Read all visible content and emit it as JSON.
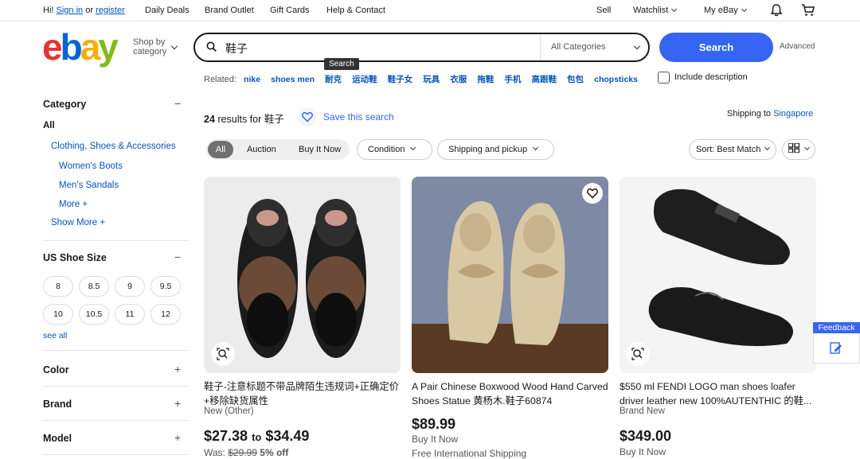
{
  "topbar": {
    "greeting": "Hi!",
    "sign_in": "Sign in",
    "or": "or",
    "register": "register",
    "daily_deals": "Daily Deals",
    "brand_outlet": "Brand Outlet",
    "gift_cards": "Gift Cards",
    "help_contact": "Help & Contact",
    "sell": "Sell",
    "watchlist": "Watchlist",
    "my_ebay": "My eBay"
  },
  "header": {
    "logo_letters": [
      "e",
      "b",
      "a",
      "y"
    ],
    "shop_by_line1": "Shop by",
    "shop_by_line2": "category",
    "search_query": "鞋子",
    "category_select": "All Categories",
    "tooltip": "Search",
    "search_button": "Search",
    "advanced": "Advanced",
    "related_label": "Related:",
    "related": [
      "nike",
      "shoes men",
      "耐克",
      "运动鞋",
      "鞋子女",
      "玩具",
      "衣服",
      "拖鞋",
      "手机",
      "高跟鞋",
      "包包",
      "chopsticks"
    ],
    "include_description": "Include description"
  },
  "sidebar": {
    "category_title": "Category",
    "all": "All",
    "category_items": [
      "Clothing, Shoes & Accessories",
      "Women's Boots",
      "Men's Sandals",
      "More +"
    ],
    "show_more": "Show More +",
    "size_title": "US Shoe Size",
    "sizes": [
      "8",
      "8.5",
      "9",
      "9.5",
      "10",
      "10.5",
      "11",
      "12"
    ],
    "see_all": "see all",
    "color_title": "Color",
    "brand_title": "Brand",
    "model_title": "Model"
  },
  "results": {
    "count_prefix": "24",
    "count_mid": "results for",
    "count_query": "鞋子",
    "save_search": "Save this search",
    "shipping_to": "Shipping to",
    "shipping_country": "Singapore",
    "filters": [
      "All",
      "Auction",
      "Buy It Now"
    ],
    "condition": "Condition",
    "shipping_pickup": "Shipping and pickup",
    "sort": "Sort: Best Match"
  },
  "products": [
    {
      "title": "鞋子-注意标题不带品牌陌生违规词+正确定价+移除缺货属性",
      "condition": "New (Other)",
      "price_low": "$27.38",
      "price_to": "to",
      "price_high": "$34.49",
      "was_label": "Was:",
      "was_price": "$29.99",
      "discount": "5% off"
    },
    {
      "title": "A Pair Chinese Boxwood Wood Hand Carved Shoes Statue 黄杨木.鞋子60874",
      "price": "$89.99",
      "buy_it_now": "Buy It Now",
      "shipping": "Free International Shipping"
    },
    {
      "title": "$550 ml FENDI LOGO man shoes loafer driver leather new 100%AUTENTHIC 的鞋...",
      "condition": "Brand New",
      "price": "$349.00",
      "buy_it_now": "Buy It Now"
    }
  ],
  "feedback": "Feedback",
  "colors": {
    "accent": "#3665f3",
    "link": "#0654ba"
  }
}
